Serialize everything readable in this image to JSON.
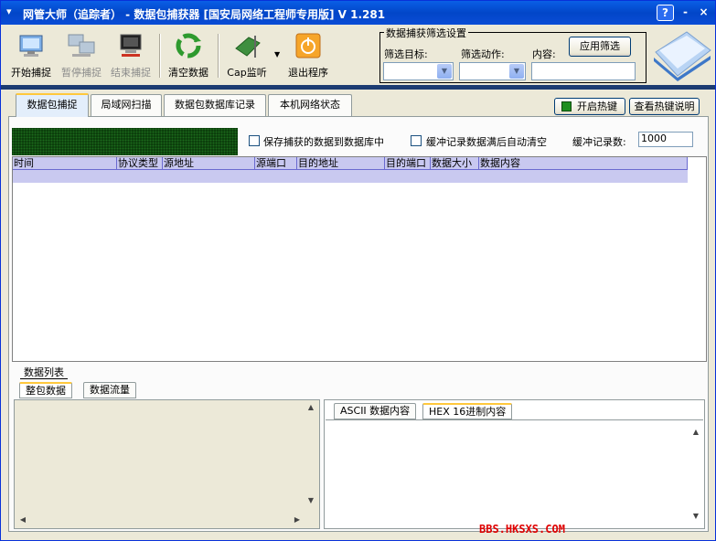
{
  "window": {
    "title": "网管大师（追踪者） - 数据包捕获器 [国安局网络工程师专用版] V 1.281",
    "help_label": "?",
    "minimize_label": "-",
    "close_label": "×"
  },
  "toolbar": {
    "start_label": "开始捕捉",
    "pause_label": "暂停捕捉",
    "stop_label": "结束捕捉",
    "clear_label": "清空数据",
    "cap_label": "Cap监听",
    "exit_label": "退出程序"
  },
  "filter": {
    "group_title": "数据捕获筛选设置",
    "target_label": "筛选目标:",
    "action_label": "筛选动作:",
    "content_label": "内容:",
    "apply_label": "应用筛选",
    "target_value": "",
    "action_value": "",
    "content_value": ""
  },
  "tabs": [
    "数据包捕捉",
    "局域网扫描",
    "数据包数据库记录",
    "本机网络状态"
  ],
  "hotkey": {
    "enable_label": "开启热键",
    "help_label": "查看热键说明"
  },
  "options": {
    "save_db_label": "保存捕获的数据到数据库中",
    "auto_clear_label": "缓冲记录数据满后自动清空",
    "buffer_label": "缓冲记录数:",
    "buffer_value": "1000"
  },
  "grid": {
    "columns": [
      "时间",
      "协议类型",
      "源地址",
      "源端口",
      "目的地址",
      "目的端口",
      "数据大小",
      "数据内容"
    ]
  },
  "list_tab_label": "数据列表",
  "bottom_tabs": [
    "整包数据",
    "数据流量"
  ],
  "right_tabs": [
    "ASCII 数据内容",
    "HEX 16进制内容"
  ],
  "watermark": "BBS.HKSXS.COM",
  "colors": {
    "title_bar": "#0a5fe6",
    "grid_header": "#c8c8f0",
    "active_tab_accent": "#ffc83c",
    "hotkey_indicator": "#1f8f1f",
    "watermark": "#e00000"
  }
}
